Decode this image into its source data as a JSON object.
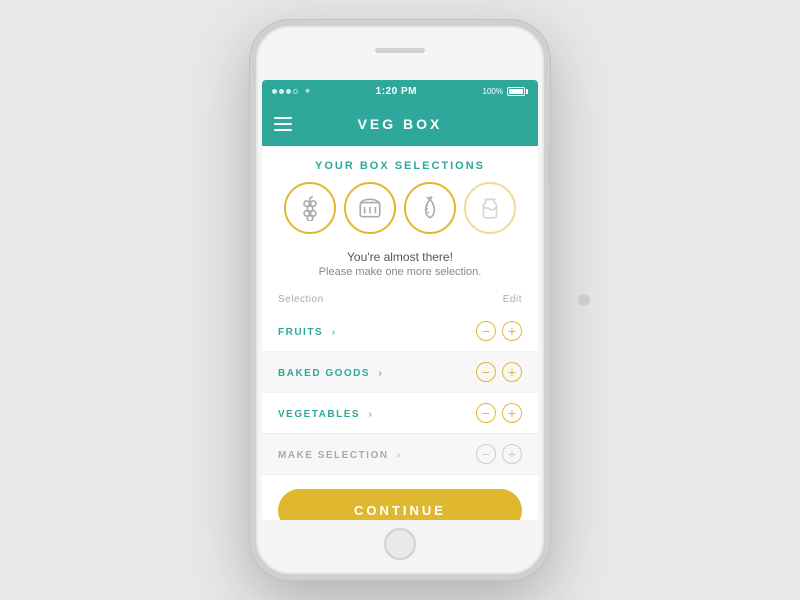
{
  "status_bar": {
    "time": "1:20 PM",
    "battery": "100%"
  },
  "header": {
    "title": "VEG BOX",
    "menu_label": "Menu"
  },
  "section": {
    "title": "YOUR BOX SELECTIONS"
  },
  "icons": [
    {
      "id": "grapes",
      "label": "Fruits icon",
      "filled": true
    },
    {
      "id": "bread",
      "label": "Baked goods icon",
      "filled": true
    },
    {
      "id": "carrot",
      "label": "Vegetables icon",
      "filled": true
    },
    {
      "id": "milk",
      "label": "Empty selection icon",
      "filled": false
    }
  ],
  "message": {
    "main": "You're almost there!",
    "sub": "Please make one more selection."
  },
  "list_headers": {
    "selection": "Selection",
    "edit": "Edit"
  },
  "list_items": [
    {
      "label": "FRUITS",
      "dim": false,
      "shaded": false
    },
    {
      "label": "BAKED GOODS",
      "dim": false,
      "shaded": true
    },
    {
      "label": "VEGETABLES",
      "dim": false,
      "shaded": false
    },
    {
      "label": "MAKE SELECTION",
      "dim": true,
      "shaded": true
    }
  ],
  "continue_button": {
    "label": "CONTINUE"
  }
}
